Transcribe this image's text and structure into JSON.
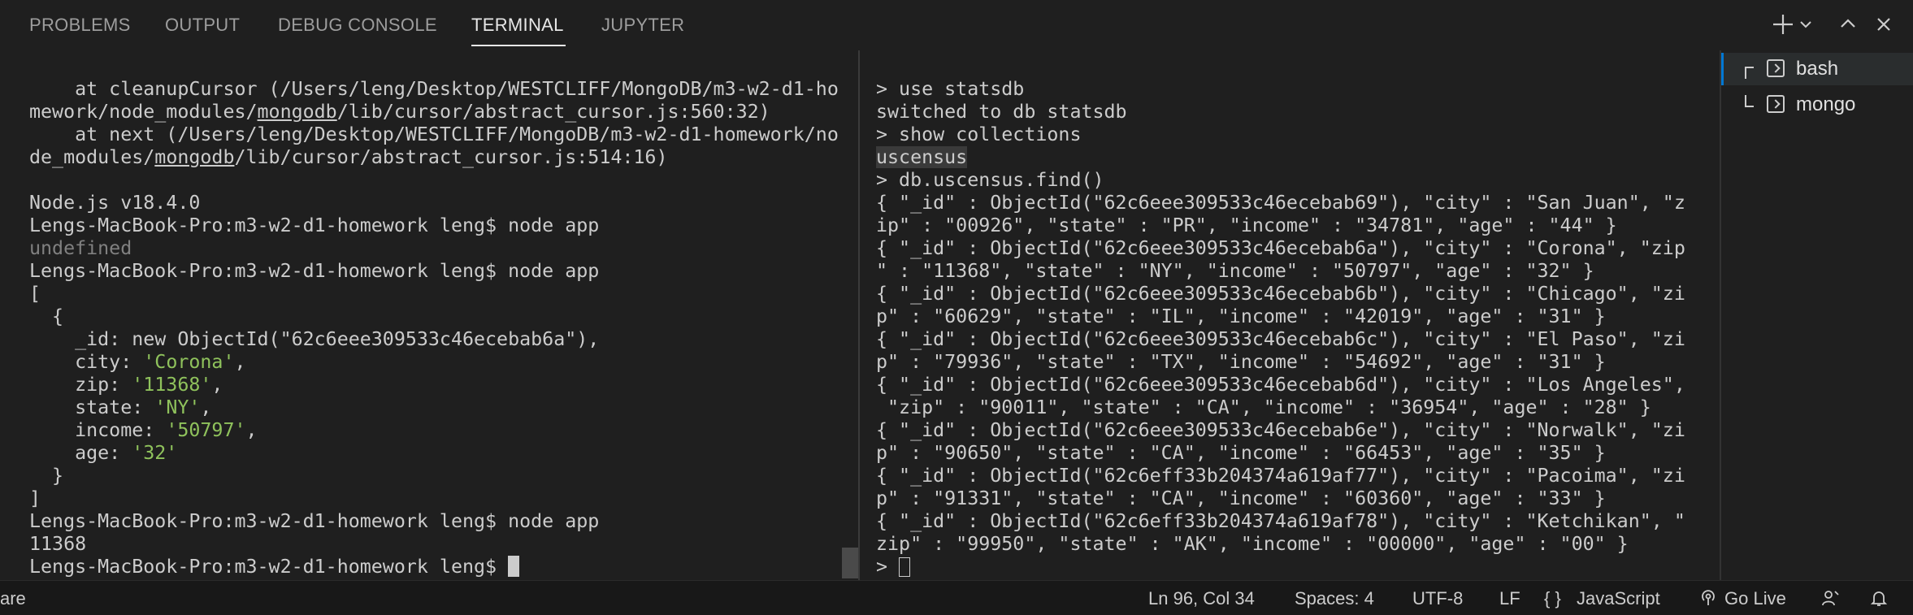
{
  "tabs": {
    "problems": "PROBLEMS",
    "output": "OUTPUT",
    "debug_console": "DEBUG CONSOLE",
    "terminal": "TERMINAL",
    "jupyter": "JUPYTER"
  },
  "active_tab": "TERMINAL",
  "toolbar_icons": [
    "plus-icon",
    "chevron-down-icon",
    "chevron-up-icon",
    "close-icon"
  ],
  "left_terminal": {
    "l1": "    at cleanupCursor (/Users/leng/Desktop/WESTCLIFF/MongoDB/m3-w2-d1-ho",
    "l2a": "mework/node_modules/",
    "l2b": "mongodb",
    "l2c": "/lib/cursor/abstract_cursor.js:560:32)",
    "l3": "    at next (/Users/leng/Desktop/WESTCLIFF/MongoDB/m3-w2-d1-homework/no",
    "l4a": "de_modules/",
    "l4b": "mongodb",
    "l4c": "/lib/cursor/abstract_cursor.js:514:16)",
    "l6": "Node.js v18.4.0",
    "l7": "Lengs-MacBook-Pro:m3-w2-d1-homework leng$ node app",
    "l8": "undefined",
    "l9": "Lengs-MacBook-Pro:m3-w2-d1-homework leng$ node app",
    "l10": "[",
    "l11": "  {",
    "l12": "    _id: new ObjectId(\"62c6eee309533c46ecebab6a\"),",
    "l13_key": "    city: ",
    "l13_val": "'Corona'",
    "l14_key": "    zip: ",
    "l14_val": "'11368'",
    "l15_key": "    state: ",
    "l15_val": "'NY'",
    "l16_key": "    income: ",
    "l16_val": "'50797'",
    "l17_key": "    age: ",
    "l17_val": "'32'",
    "comma": ",",
    "l18": "  }",
    "l19": "]",
    "l20": "Lengs-MacBook-Pro:m3-w2-d1-homework leng$ node app",
    "l21": "11368",
    "l22": "Lengs-MacBook-Pro:m3-w2-d1-homework leng$ "
  },
  "right_terminal": {
    "r1": "> use statsdb",
    "r2": "switched to db statsdb",
    "r3": "> show collections",
    "r4": "uscensus",
    "r5": "> db.uscensus.find()",
    "r6": "{ \"_id\" : ObjectId(\"62c6eee309533c46ecebab69\"), \"city\" : \"San Juan\", \"z",
    "r7": "ip\" : \"00926\", \"state\" : \"PR\", \"income\" : \"34781\", \"age\" : \"44\" }",
    "r8": "{ \"_id\" : ObjectId(\"62c6eee309533c46ecebab6a\"), \"city\" : \"Corona\", \"zip",
    "r9": "\" : \"11368\", \"state\" : \"NY\", \"income\" : \"50797\", \"age\" : \"32\" }",
    "r10": "{ \"_id\" : ObjectId(\"62c6eee309533c46ecebab6b\"), \"city\" : \"Chicago\", \"zi",
    "r11": "p\" : \"60629\", \"state\" : \"IL\", \"income\" : \"42019\", \"age\" : \"31\" }",
    "r12": "{ \"_id\" : ObjectId(\"62c6eee309533c46ecebab6c\"), \"city\" : \"El Paso\", \"zi",
    "r13": "p\" : \"79936\", \"state\" : \"TX\", \"income\" : \"54692\", \"age\" : \"31\" }",
    "r14": "{ \"_id\" : ObjectId(\"62c6eee309533c46ecebab6d\"), \"city\" : \"Los Angeles\",",
    "r15": " \"zip\" : \"90011\", \"state\" : \"CA\", \"income\" : \"36954\", \"age\" : \"28\" }",
    "r16": "{ \"_id\" : ObjectId(\"62c6eee309533c46ecebab6e\"), \"city\" : \"Norwalk\", \"zi",
    "r17": "p\" : \"90650\", \"state\" : \"CA\", \"income\" : \"66453\", \"age\" : \"35\" }",
    "r18": "{ \"_id\" : ObjectId(\"62c6eff33b204374a619af77\"), \"city\" : \"Pacoima\", \"zi",
    "r19": "p\" : \"91331\", \"state\" : \"CA\", \"income\" : \"60360\", \"age\" : \"33\" }",
    "r20": "{ \"_id\" : ObjectId(\"62c6eff33b204374a619af78\"), \"city\" : \"Ketchikan\", \"",
    "r21": "zip\" : \"99950\", \"state\" : \"AK\", \"income\" : \"00000\", \"age\" : \"00\" }",
    "r22": "> "
  },
  "terminal_list": {
    "items": [
      {
        "label": "bash",
        "icon": "terminal-icon",
        "active": true
      },
      {
        "label": "mongo",
        "icon": "terminal-icon",
        "active": false
      }
    ]
  },
  "statusbar": {
    "left_fragment": "are",
    "position": "Ln 96, Col 34",
    "spaces": "Spaces: 4",
    "encoding": "UTF-8",
    "eol": "LF",
    "language_braces": "{ }",
    "language": "JavaScript",
    "go_live": "Go Live"
  },
  "colors": {
    "background": "#1f1f1f",
    "text": "#cccccc",
    "string_green": "#8fc25c",
    "active_border": "#0078d4"
  }
}
